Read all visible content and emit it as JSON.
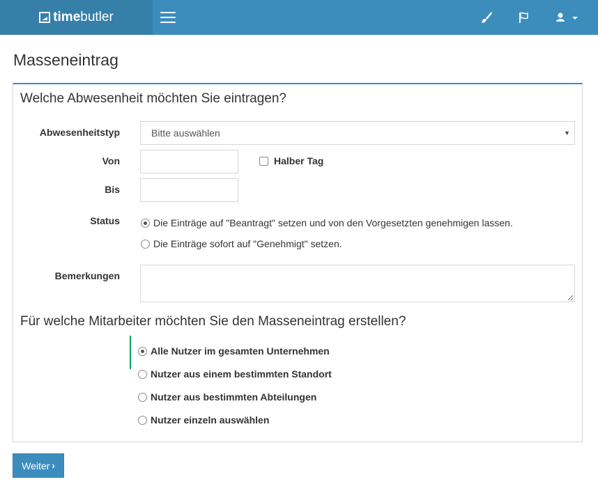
{
  "header": {
    "logo_bold": "time",
    "logo_light": "butler",
    "icons": [
      "menu-icon",
      "brush-icon",
      "flag-icon",
      "user-icon",
      "caret-down-icon"
    ]
  },
  "page": {
    "title": "Masseneintrag"
  },
  "absence": {
    "section_title": "Welche Abwesenheit möchten Sie eintragen?",
    "type_label": "Abwesenheitstyp",
    "type_value": "Bitte auswählen",
    "from_label": "Von",
    "from_value": "",
    "half_day_label": "Halber Tag",
    "half_day_checked": false,
    "to_label": "Bis",
    "to_value": "",
    "status_label": "Status",
    "status_options": [
      {
        "label": "Die Einträge auf \"Beantragt\" setzen und von den Vorgesetzten genehmigen lassen.",
        "checked": true
      },
      {
        "label": "Die Einträge sofort auf \"Genehmigt\" setzen.",
        "checked": false
      }
    ],
    "remarks_label": "Bemerkungen",
    "remarks_value": ""
  },
  "employees": {
    "section_title": "Für welche Mitarbeiter möchten Sie den Masseneintrag erstellen?",
    "options": [
      {
        "label": "Alle Nutzer im gesamten Unternehmen",
        "checked": true
      },
      {
        "label": "Nutzer aus einem bestimmten Standort",
        "checked": false
      },
      {
        "label": "Nutzer aus bestimmten Abteilungen",
        "checked": false
      },
      {
        "label": "Nutzer einzeln auswählen",
        "checked": false
      }
    ]
  },
  "actions": {
    "next_label": "Weiter",
    "next_icon": "chevron-right-icon"
  },
  "colors": {
    "header": "#3c8dbc",
    "logo_bg": "#367fa9",
    "accent_green": "#00a65a"
  }
}
